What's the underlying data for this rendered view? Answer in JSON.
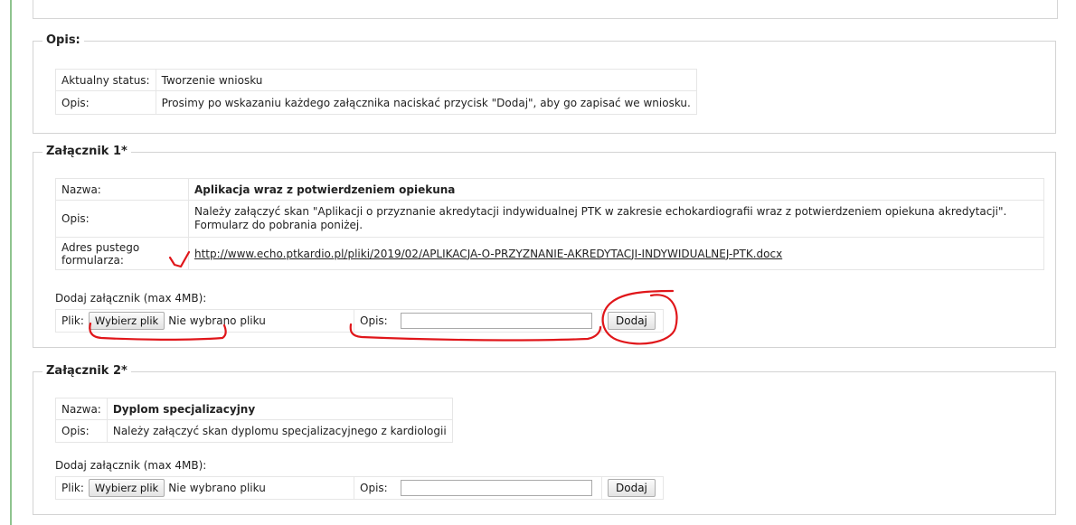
{
  "opis_section": {
    "legend": "Opis:",
    "status_label": "Aktualny status:",
    "status_value": "Tworzenie wniosku",
    "opis_label": "Opis:",
    "opis_value": "Prosimy po wskazaniu każdego załącznika naciskać przycisk \"Dodaj\", aby go zapisać we wniosku."
  },
  "attachment1": {
    "legend": "Załącznik 1*",
    "nazwa_label": "Nazwa:",
    "nazwa_value": "Aplikacja wraz z potwierdzeniem opiekuna",
    "opis_label": "Opis:",
    "opis_value": "Należy załączyć skan \"Aplikacji o przyznanie akredytacji indywidualnej PTK w zakresie echokardiografii wraz z potwierdzeniem opiekuna akredytacji\". Formularz do pobrania poniżej.",
    "adres_label_line1": "Adres pustego",
    "adres_label_line2": "formularza:",
    "adres_link": "http://www.echo.ptkardio.pl/pliki/2019/02/APLIKACJA-O-PRZYZNANIE-AKREDYTACJI-INDYWIDUALNEJ-PTK.docx",
    "add_label": "Dodaj załącznik (max 4MB):",
    "plik_label": "Plik:",
    "choose_button": "Wybierz plik",
    "no_file_text": "Nie wybrano pliku",
    "desc_label": "Opis:",
    "desc_value": "",
    "add_button": "Dodaj"
  },
  "attachment2": {
    "legend": "Załącznik 2*",
    "nazwa_label": "Nazwa:",
    "nazwa_value": "Dyplom specjalizacyjny",
    "opis_label": "Opis:",
    "opis_value": "Należy załączyć skan dyplomu specjalizacyjnego z kardiologii",
    "add_label": "Dodaj załącznik (max 4MB):",
    "plik_label": "Plik:",
    "choose_button": "Wybierz plik",
    "no_file_text": "Nie wybrano pliku",
    "desc_label": "Opis:",
    "desc_value": "",
    "add_button": "Dodaj"
  },
  "colors": {
    "annotation": "#e0161a",
    "left_rule": "#8fc48f",
    "border": "#d3d3d3"
  }
}
